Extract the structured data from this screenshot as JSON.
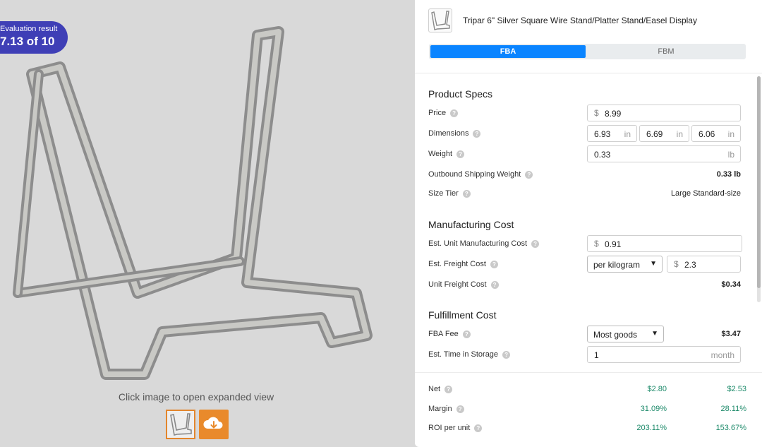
{
  "evaluation": {
    "label": "Evaluation result",
    "score": "7.13 of 10"
  },
  "image": {
    "hint": "Click image to open expanded view",
    "thumbnail_icon": "product-thumbnail",
    "download_icon": "cloud-download-icon"
  },
  "header": {
    "title": "Tripar 6\" Silver Square Wire Stand/Platter Stand/Easel Display",
    "tabs": [
      "FBA",
      "FBM"
    ],
    "active_tab": "FBA"
  },
  "product_specs": {
    "title": "Product Specs",
    "price": {
      "label": "Price",
      "prefix": "$",
      "value": "8.99"
    },
    "dimensions": {
      "label": "Dimensions",
      "values": [
        "6.93",
        "6.69",
        "6.06"
      ],
      "unit": "in"
    },
    "weight": {
      "label": "Weight",
      "value": "0.33",
      "unit": "lb"
    },
    "outbound": {
      "label": "Outbound Shipping Weight",
      "value": "0.33 lb"
    },
    "size_tier": {
      "label": "Size Tier",
      "value": "Large Standard-size"
    }
  },
  "manufacturing": {
    "title": "Manufacturing Cost",
    "unit_cost": {
      "label": "Est. Unit Manufacturing Cost",
      "prefix": "$",
      "value": "0.91"
    },
    "freight": {
      "label": "Est. Freight Cost",
      "basis": "per kilogram",
      "prefix": "$",
      "value": "2.3"
    },
    "unit_freight": {
      "label": "Unit Freight Cost",
      "value": "$0.34"
    }
  },
  "fulfillment": {
    "title": "Fulfillment Cost",
    "fba_fee": {
      "label": "FBA Fee",
      "option": "Most goods",
      "value": "$3.47"
    },
    "storage": {
      "label": "Est. Time in Storage",
      "value": "1",
      "unit": "month"
    }
  },
  "summary": {
    "net": {
      "label": "Net",
      "v1": "$2.80",
      "v2": "$2.53"
    },
    "margin": {
      "label": "Margin",
      "v1": "31.09%",
      "v2": "28.11%"
    },
    "roi": {
      "label": "ROI per unit",
      "v1": "203.11%",
      "v2": "153.67%"
    }
  },
  "colors": {
    "accent": "#0a84ff",
    "badge": "#3f3fb6",
    "positive": "#1d8a6a",
    "download": "#e98a2b"
  }
}
